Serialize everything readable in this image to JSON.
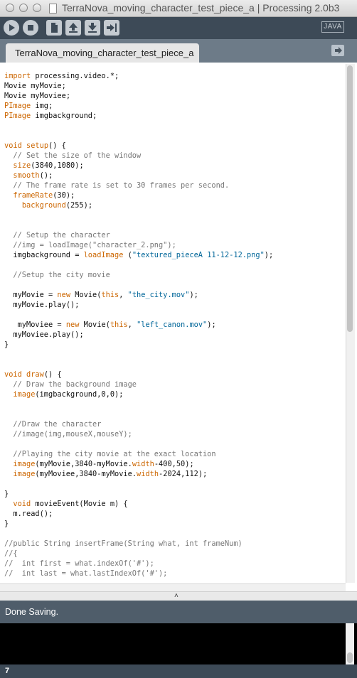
{
  "window": {
    "title": "TerraNova_moving_character_test_piece_a | Processing 2.0b3"
  },
  "toolbar": {
    "buttons": [
      "run-icon",
      "stop-icon",
      "new-icon",
      "open-icon",
      "save-icon",
      "export-icon"
    ],
    "mode_label": "JAVA"
  },
  "tabs": [
    {
      "label": "TerraNova_moving_character_test_piece_a"
    }
  ],
  "code_lines": [
    "import processing.video.*;",
    "Movie myMovie;",
    "Movie myMoviee;",
    "PImage img;",
    "PImage imgbackground;",
    "",
    "",
    "void setup() {",
    "  // Set the size of the window",
    "  size(3840,1080);",
    "  smooth();",
    "  // The frame rate is set to 30 frames per second.",
    "  frameRate(30);",
    "    background(255);",
    "",
    "",
    "  // Setup the character",
    "  //img = loadImage(\"character_2.png\");",
    "  imgbackground = loadImage (\"textured_pieceA 11-12-12.png\");",
    "",
    "  //Setup the city movie",
    "",
    "  myMovie = new Movie(this, \"the_city.mov\");",
    "  myMovie.play();",
    "",
    "   myMoviee = new Movie(this, \"left_canon.mov\");",
    "  myMoviee.play();",
    "}",
    "",
    "",
    "void draw() {",
    "  // Draw the background image",
    "  image(imgbackground,0,0);",
    "",
    "",
    "  //Draw the character",
    "  //image(img,mouseX,mouseY);",
    "",
    "  //Playing the city movie at the exact location",
    "  image(myMovie,3840-myMovie.width-400,50);",
    "  image(myMoviee,3840-myMovie.width-2024,112);",
    "",
    "}",
    "  void movieEvent(Movie m) {",
    "  m.read();",
    "}",
    "",
    "//public String insertFrame(String what, int frameNum)",
    "//{",
    "//  int first = what.indexOf('#');",
    "//  int last = what.lastIndexOf('#');"
  ],
  "status": {
    "message": "Done Saving."
  },
  "footer": {
    "line_number": "7"
  },
  "colors": {
    "keyword": "#cc6600",
    "string": "#006699",
    "comment": "#777777",
    "toolbar_bg": "#3d4a57",
    "tabbar_bg": "#6d7b88",
    "status_bg": "#4f5d6a"
  }
}
